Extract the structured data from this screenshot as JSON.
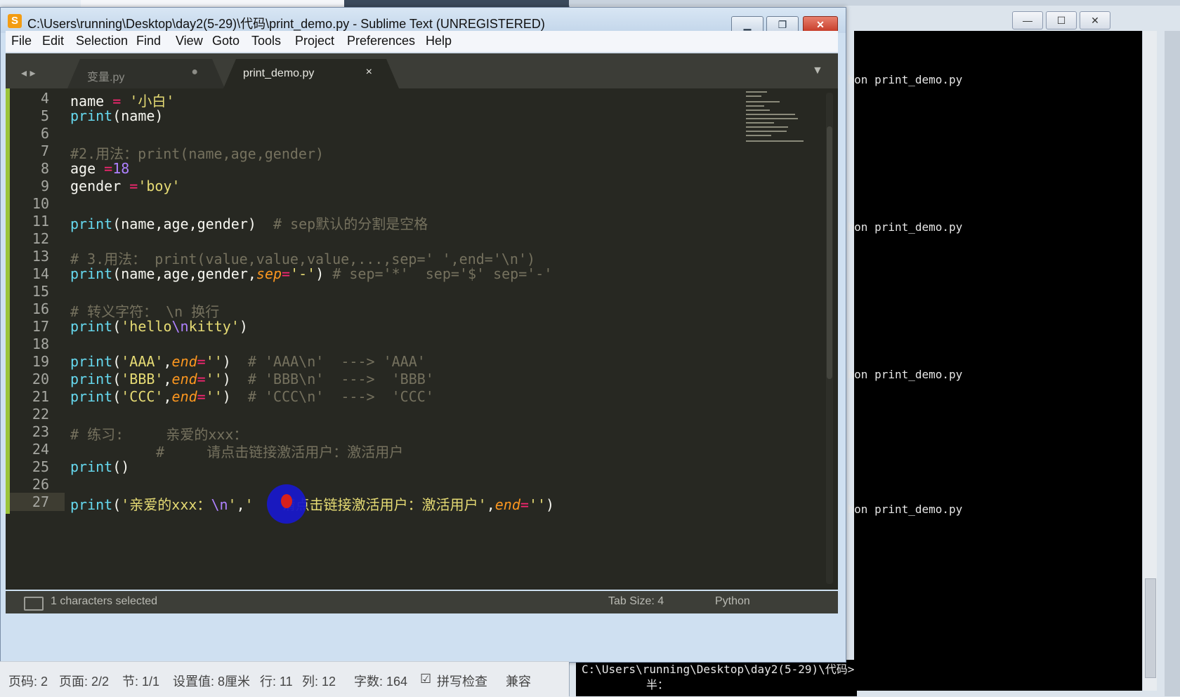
{
  "window": {
    "title": "C:\\Users\\running\\Desktop\\day2(5-29)\\代码\\print_demo.py - Sublime Text (UNREGISTERED)",
    "app_icon": "S",
    "minimize_icon": "minimize-icon",
    "maximize_icon": "maximize-icon",
    "close_icon": "close-icon"
  },
  "menu": [
    "File",
    "Edit",
    "Selection",
    "Find",
    "View",
    "Goto",
    "Tools",
    "Project",
    "Preferences",
    "Help"
  ],
  "tabs": [
    {
      "label": "变量.py",
      "dirty_mark": "●",
      "active": false
    },
    {
      "label": "print_demo.py",
      "close_mark": "×",
      "active": true
    }
  ],
  "tab_nav": "◂ ▸",
  "tab_dropdown": "▼",
  "editor": {
    "line_numbers": [
      "4",
      "5",
      "6",
      "7",
      "8",
      "9",
      "10",
      "11",
      "12",
      "13",
      "14",
      "15",
      "16",
      "17",
      "18",
      "19",
      "20",
      "21",
      "22",
      "23",
      "24",
      "25",
      "26",
      "27"
    ],
    "lines": {
      "l4": [
        "name ",
        "= ",
        "'小白'"
      ],
      "l5": [
        "print",
        "(name)"
      ],
      "l7": "#2.用法：print(name,age,gender)",
      "l8": [
        "age ",
        "=",
        "18"
      ],
      "l9": [
        "gender ",
        "=",
        "'boy'"
      ],
      "l11": [
        "print",
        "(name,age,gender)  ",
        "# sep默认的分割是空格"
      ],
      "l13": "# 3.用法： print(value,value,value,...,sep=' ',end='\\n')",
      "l14": [
        "print",
        "(name,age,gender,",
        "sep",
        "=",
        "'-'",
        ") ",
        "# sep='*'  sep='$' sep='-'"
      ],
      "l16": "# 转义字符： \\n 换行",
      "l17": [
        "print",
        "(",
        "'hello",
        "\\n",
        "kitty'",
        ")"
      ],
      "l19": [
        "print",
        "(",
        "'AAA'",
        ",",
        "end",
        "=",
        "''",
        ")  ",
        "# 'AAA\\n'  ---> 'AAA'"
      ],
      "l20": [
        "print",
        "(",
        "'BBB'",
        ",",
        "end",
        "=",
        "''",
        ")  ",
        "# 'BBB\\n'  --->  'BBB'"
      ],
      "l21": [
        "print",
        "(",
        "'CCC'",
        ",",
        "end",
        "=",
        "''",
        ")  ",
        "# 'CCC\\n'  --->  'CCC'"
      ],
      "l23": "# 练习:     亲爱的xxx：",
      "l24": "#     请点击链接激活用户：激活用户",
      "l25": [
        "print",
        "()"
      ],
      "l27": [
        "print",
        "(",
        "'亲爱的xxx：",
        "\\n",
        "'",
        ",",
        "'",
        "请点击链接激活用户：激活用户'",
        ",",
        "end",
        "=",
        "''",
        ")"
      ]
    }
  },
  "status": {
    "selection": "1 characters selected",
    "tab_size": "Tab Size: 4",
    "syntax": "Python"
  },
  "console": {
    "lines": [
      "码>python print_demo.py",
      "码>python print_demo.py",
      "码>python print_demo.py",
      "码>python print_demo.py"
    ],
    "prompt": "C:\\Users\\running\\Desktop\\day2(5-29)\\代码>",
    "ime": "半："
  },
  "wordbar": {
    "page": "页码: 2",
    "pages": "页面: 2/2",
    "section": "节: 1/1",
    "setting": "设置值: 8厘米",
    "row": "行: 11",
    "col": "列: 12",
    "wordcount": "字数: 164",
    "spell": "拼写检查",
    "compat": "兼容"
  },
  "colors": {
    "editor_bg": "#272822",
    "keyword": "#66d9ef",
    "string": "#e6db74",
    "operator": "#f92672",
    "number": "#ae81ff",
    "comment": "#75715e",
    "param": "#fd971f"
  }
}
